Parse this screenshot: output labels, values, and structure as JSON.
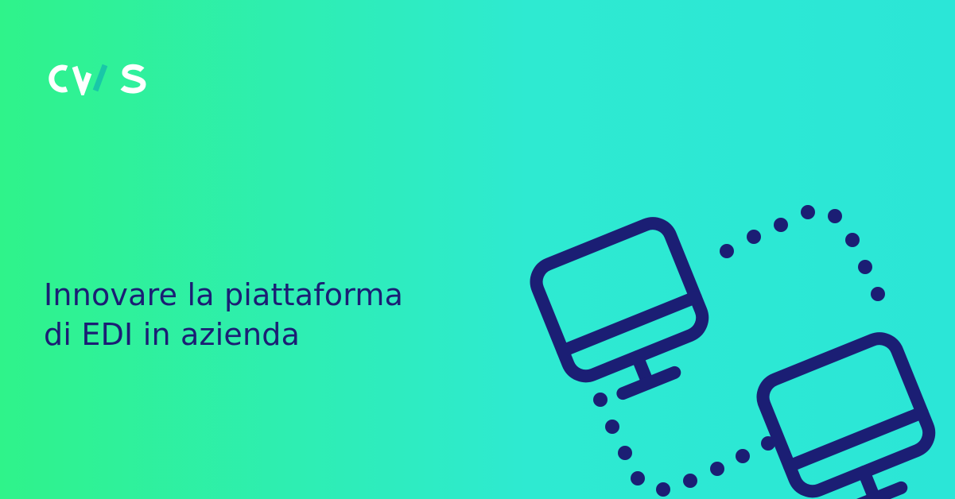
{
  "brand": {
    "logo_text": "CWS",
    "logo_colors": {
      "letters": "#ffffff",
      "slash_accent": "#19c7a8"
    }
  },
  "headline": {
    "line1": "Innovare la piattaforma",
    "line2": "di EDI in azienda"
  },
  "illustration": {
    "icon_names": [
      "computer-monitor-icon",
      "computer-monitor-icon",
      "dotted-connection-icon"
    ]
  },
  "colors": {
    "gradient_start": "#2ff38a",
    "gradient_end": "#2be6d7",
    "text_and_icons": "#1b1e74"
  }
}
